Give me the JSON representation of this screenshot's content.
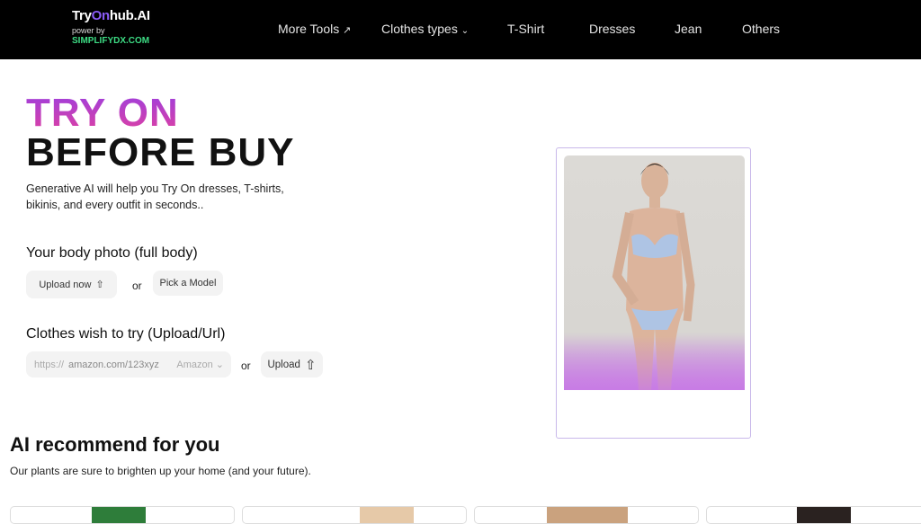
{
  "nav": {
    "logo_pre": "Try",
    "logo_o": "On",
    "logo_post": "hub.AI",
    "power": "power by",
    "brand": "SIMPLIFYDX.COM",
    "items": [
      "More Tools",
      "Clothes types",
      "T-Shirt",
      "Dresses",
      "Jean",
      "Others"
    ]
  },
  "hero": {
    "line1": "TRY ON",
    "line2": "BEFORE BUY",
    "desc": "Generative AI will help you Try On dresses, T-shirts, bikinis, and every outfit in seconds.."
  },
  "body": {
    "label": "Your body photo (full body)",
    "upload": "Upload now",
    "or": "or",
    "pick": "Pick a Model"
  },
  "clothes": {
    "label": "Clothes wish to try (Upload/Url)",
    "prefix": "https://",
    "placeholder": "amazon.com/123xyz",
    "store": "Amazon",
    "or": "or",
    "upload": "Upload"
  },
  "recommend": {
    "title": "AI recommend for you",
    "subtitle": "Our plants are sure to brighten up your home (and your future)."
  },
  "colors": {
    "accent_top": "#9b3fe0",
    "accent_bottom": "#e040a0",
    "brand_green": "#3ddc84"
  }
}
